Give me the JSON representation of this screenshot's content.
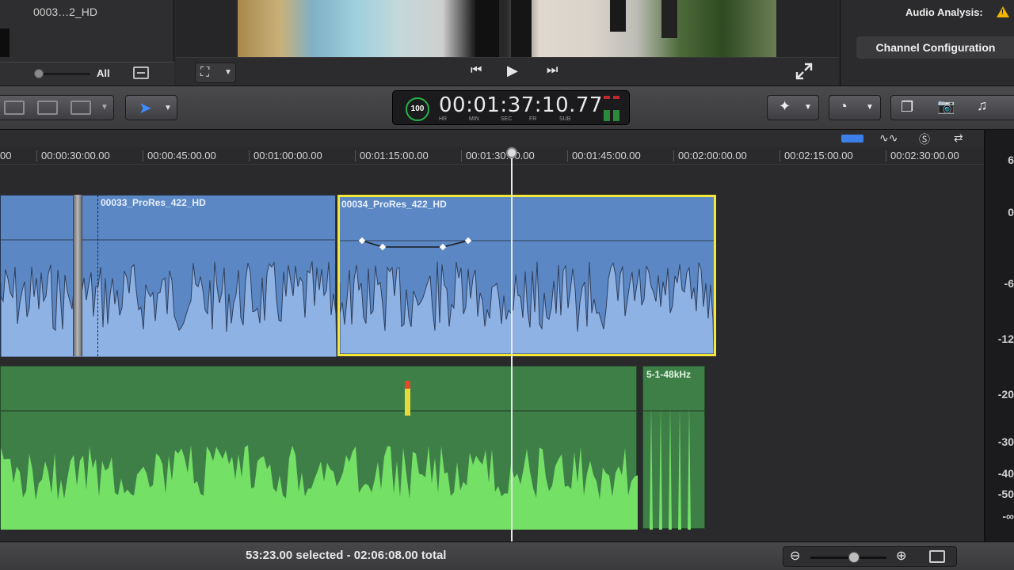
{
  "browser": {
    "clip_label": "0003…2_HD",
    "filter_label": "All"
  },
  "viewer": {
    "transform_icon": "transform-icon",
    "prev_icon": "⏮",
    "play_icon": "▶",
    "next_icon": "⏭",
    "fullscreen_icon": "fullscreen-icon"
  },
  "inspector": {
    "audio_analysis_label": "Audio Analysis:",
    "channel_config_label": "Channel Configuration"
  },
  "dashboard": {
    "percent": "100",
    "timecode": "00:01:37:10.77",
    "units": [
      "HR",
      "MIN",
      "SEC",
      "FR",
      "SUB"
    ]
  },
  "timeline": {
    "ruler_ticks": [
      "00:00:30:00.00",
      "00:00:45:00.00",
      "00:01:00:00.00",
      "00:01:15:00.00",
      "00:01:30:00.00",
      "00:01:45:00.00",
      "00:02:00:00.00",
      "00:02:15:00.00",
      "00:02:30:00.00"
    ],
    "ruler_prefix": "00",
    "clips": {
      "video1": "00033_ProRes_422_HD",
      "video2": "00034_ProRes_422_HD",
      "audio_small": "5-1-48kHz"
    }
  },
  "meter": {
    "labels": [
      "6",
      "0",
      "-6",
      "-12",
      "-20",
      "-30",
      "-40",
      "-50",
      "-∞"
    ]
  },
  "footer": {
    "status": "53:23.00 selected - 02:06:08.00 total"
  },
  "colors": {
    "video_clip": "#5b88c4",
    "audio_clip": "#3e7f48",
    "selection": "#f3e83a",
    "accent_blue": "#3d8cff"
  }
}
